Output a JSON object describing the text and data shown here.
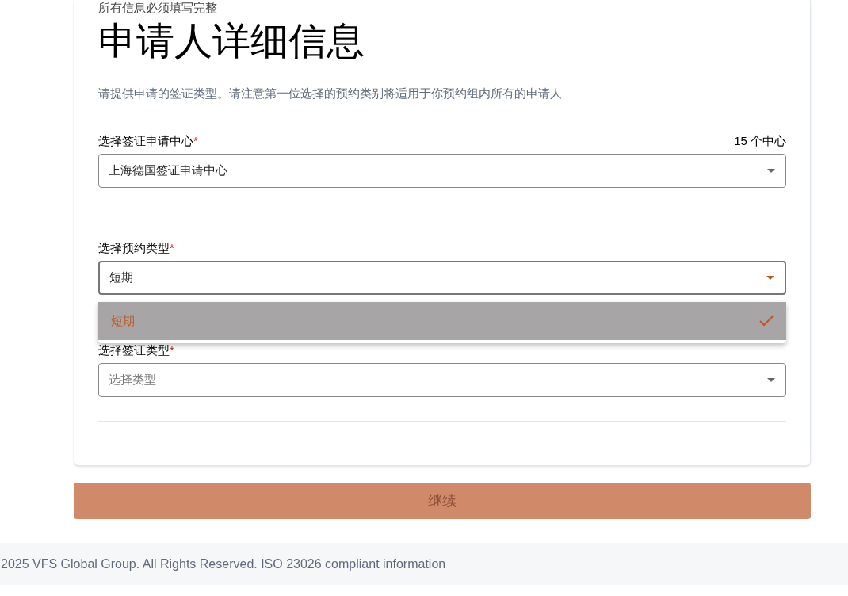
{
  "form": {
    "notice": "所有信息必须填写完整",
    "title": "申请人详细信息",
    "description": "请提供申请的签证类型。请注意第一位选择的预约类别将适用于你预约组内所有的申请人",
    "fields": [
      {
        "label": "选择签证申请中心",
        "required_mark": "*",
        "count": "15 个中心",
        "value": "上海德国签证申请中心",
        "focused": false
      },
      {
        "label": "选择预约类型",
        "required_mark": "*",
        "value": "短期",
        "focused": true,
        "options": [
          {
            "label": "短期",
            "selected": true
          }
        ]
      },
      {
        "label": "选择签证类型",
        "required_mark": "*",
        "placeholder": "选择类型",
        "focused": false
      }
    ]
  },
  "continue_button": {
    "label": "继续",
    "disabled": true
  },
  "footer": {
    "text": "2025 VFS Global Group. All Rights Reserved. ISO 23026 compliant information"
  }
}
